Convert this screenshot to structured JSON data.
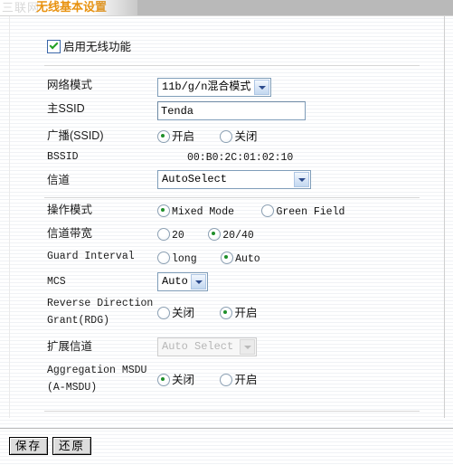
{
  "titlebar": {
    "watermark": "三联网",
    "title": "无线基本设置"
  },
  "enable_wireless": {
    "label": "启用无线功能",
    "checked": true
  },
  "fields": {
    "network_mode": {
      "label": "网络模式",
      "value": "11b/g/n混合模式"
    },
    "primary_ssid": {
      "label": "主SSID",
      "value": "Tenda"
    },
    "broadcast_ssid": {
      "label": "广播(SSID)",
      "option_on": "开启",
      "option_off": "关闭",
      "selected": "开启"
    },
    "bssid": {
      "label": "BSSID",
      "value": "00:B0:2C:01:02:10"
    },
    "channel": {
      "label": "信道",
      "value": "AutoSelect"
    },
    "operation_mode": {
      "label": "操作模式",
      "option_mixed": "Mixed Mode",
      "option_green": "Green Field",
      "selected": "Mixed Mode"
    },
    "channel_bandwidth": {
      "label": "信道带宽",
      "option_20": "20",
      "option_2040": "20/40",
      "selected": "20/40"
    },
    "guard_interval": {
      "label": "Guard Interval",
      "option_long": "long",
      "option_auto": "Auto",
      "selected": "Auto"
    },
    "mcs": {
      "label": "MCS",
      "value": "Auto"
    },
    "rdg": {
      "label": "Reverse Direction\nGrant(RDG)",
      "option_off": "关闭",
      "option_on": "开启",
      "selected": "开启"
    },
    "extension_channel": {
      "label": "扩展信道",
      "value": "Auto Select",
      "disabled": true
    },
    "amsdu": {
      "label": "Aggregation MSDU\n(A-MSDU)",
      "option_off": "关闭",
      "option_on": "开启",
      "selected": "关闭"
    }
  },
  "buttons": {
    "save": "保存",
    "restore": "还原"
  },
  "colors": {
    "title_orange": "#e8920f",
    "titlebar_gray": "#b9b9b9",
    "input_border": "#7f9db9",
    "radio_dot": "#1f8f2a"
  }
}
